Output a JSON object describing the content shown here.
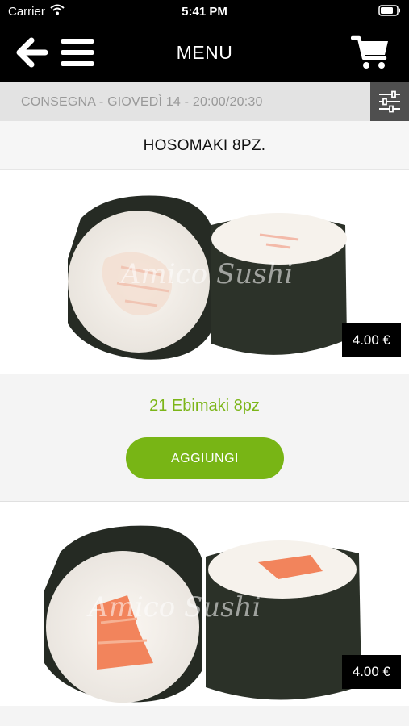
{
  "status_bar": {
    "carrier": "Carrier",
    "time": "5:41 PM"
  },
  "nav": {
    "title": "MENU",
    "icons": [
      "back-arrow-icon",
      "hamburger-menu-icon",
      "shopping-cart-icon"
    ]
  },
  "delivery": {
    "text": "CONSEGNA - GIOVEDÌ 14 - 20:00/20:30",
    "filter_icon": "sliders-icon"
  },
  "category": {
    "title": "HOSOMAKI 8PZ."
  },
  "products": [
    {
      "name": "21 Ebimaki 8pz",
      "price": "4.00 €",
      "button": "AGGIUNGI",
      "watermark": "Amico Sushi"
    },
    {
      "price": "4.00 €",
      "watermark": "Amico Sushi"
    }
  ],
  "colors": {
    "accent": "#78b515",
    "accent_text": "#7cb518",
    "bar": "#000000"
  }
}
